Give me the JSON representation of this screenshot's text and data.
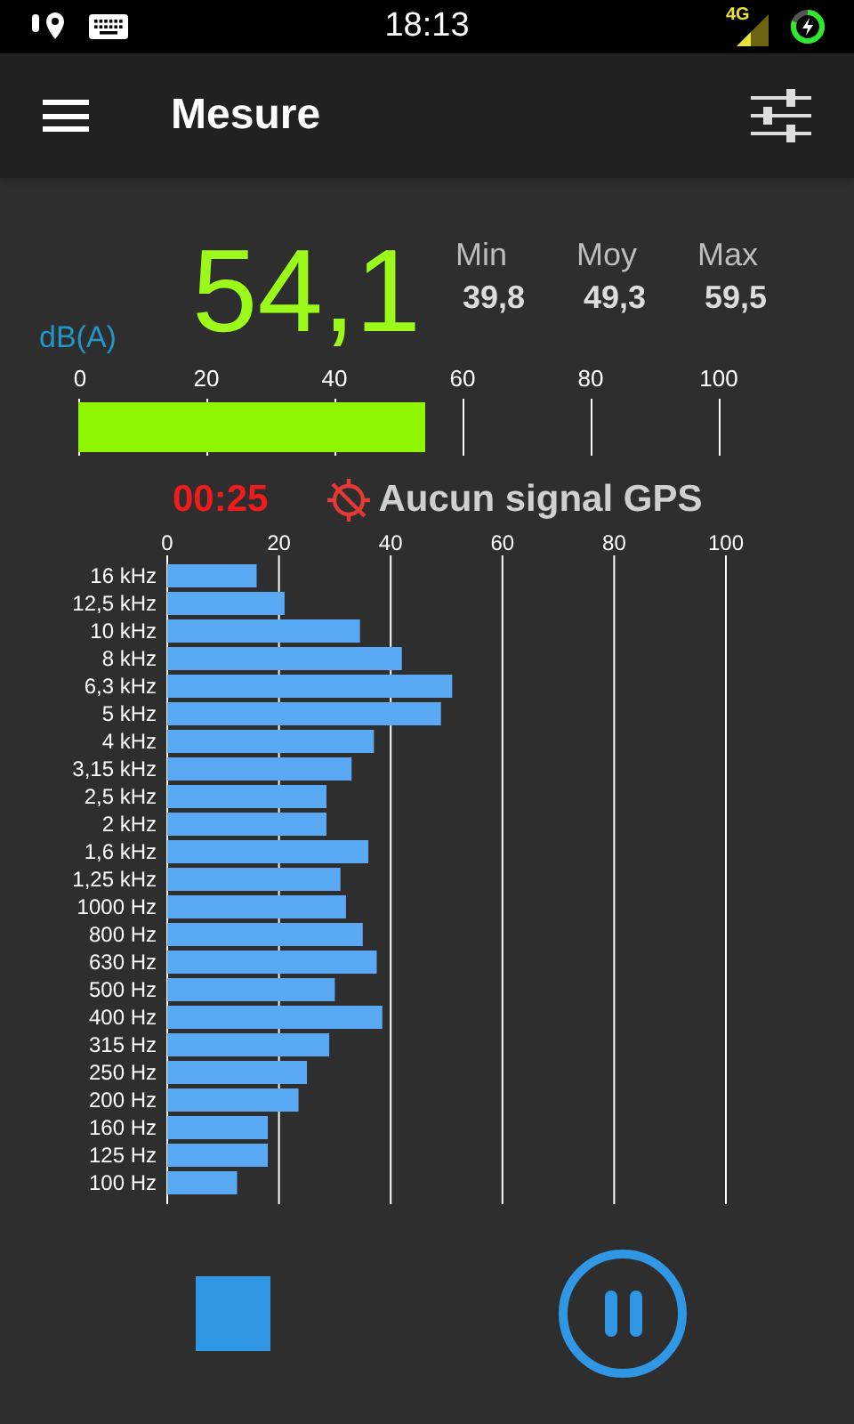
{
  "status_bar": {
    "time": "18:13",
    "network": "4G"
  },
  "app_bar": {
    "title": "Mesure"
  },
  "reading": {
    "unit": "dB(A)",
    "value": "54,1",
    "stats": [
      {
        "label": "Min",
        "value": "39,8"
      },
      {
        "label": "Moy",
        "value": "49,3"
      },
      {
        "label": "Max",
        "value": "59,5"
      }
    ]
  },
  "meter": {
    "level": 0.541,
    "ticks": [
      "0",
      "20",
      "40",
      "60",
      "80",
      "100"
    ]
  },
  "timer": "00:25",
  "gps_status": "Aucun signal GPS",
  "spectrum": {
    "chart_data": {
      "type": "bar",
      "orientation": "horizontal",
      "categories": [
        "16 kHz",
        "12,5 kHz",
        "10 kHz",
        "8 kHz",
        "6,3 kHz",
        "5 kHz",
        "4 kHz",
        "3,15 kHz",
        "2,5 kHz",
        "2 kHz",
        "1,6 kHz",
        "1,25 kHz",
        "1000 Hz",
        "800 Hz",
        "630 Hz",
        "500 Hz",
        "400 Hz",
        "315 Hz",
        "250 Hz",
        "200 Hz",
        "160 Hz",
        "125 Hz",
        "100 Hz"
      ],
      "series": [
        {
          "color": "#5aa9f5",
          "values": [
            16,
            21,
            34.5,
            42,
            51,
            49,
            37,
            33,
            28.5,
            28.5,
            36,
            31,
            32,
            35,
            37.5,
            30,
            38.5,
            29,
            25,
            23.5,
            18,
            18,
            12.5
          ]
        }
      ],
      "xlim": [
        0,
        100
      ],
      "grid": true,
      "xticks": [
        0,
        20,
        40,
        60,
        80,
        100
      ]
    }
  }
}
